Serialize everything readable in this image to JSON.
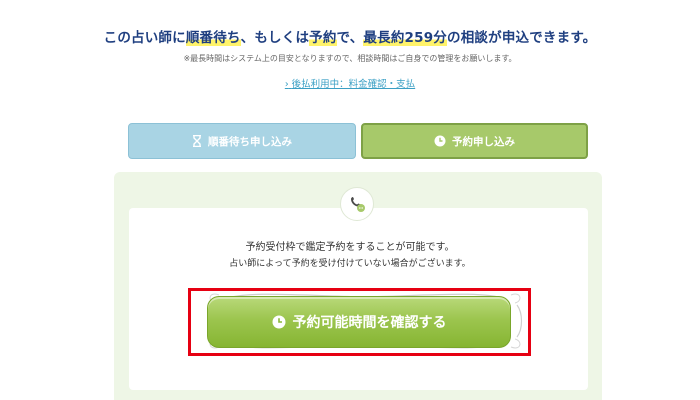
{
  "header": {
    "headline_part1": "この占い師に",
    "headline_wait": "順番待ち",
    "headline_part2": "、もしくは",
    "headline_reserve": "予約",
    "headline_part3": "で、",
    "headline_max": "最長約259分",
    "headline_part4": "の相談が申込できます。",
    "note": "※最長時間はシステム上の目安となりますので、相談時間はご自身での管理をお願いします。",
    "link_label": "後払利用中：料金確認・支払"
  },
  "tabs": {
    "wait_label": "順番待ち申し込み",
    "reserve_label": "予約申し込み"
  },
  "panel": {
    "desc_line1": "予約受付枠で鑑定予約をすることが可能です。",
    "desc_line2": "占い師によって予約を受け付けていない場合がございます。",
    "cta_label": "予約可能時間を確認する"
  },
  "colors": {
    "headline": "#1f3f80",
    "highlight": "#fff36a",
    "tab_wait": "#a9d4e4",
    "tab_reserve": "#a7c96a",
    "cta": "#9cc54e",
    "annotation_box": "#e60012"
  },
  "icons": {
    "wait": "hourglass-icon",
    "reserve": "clock-icon",
    "phone": "phone-chat-icon",
    "cta": "clock-icon"
  }
}
